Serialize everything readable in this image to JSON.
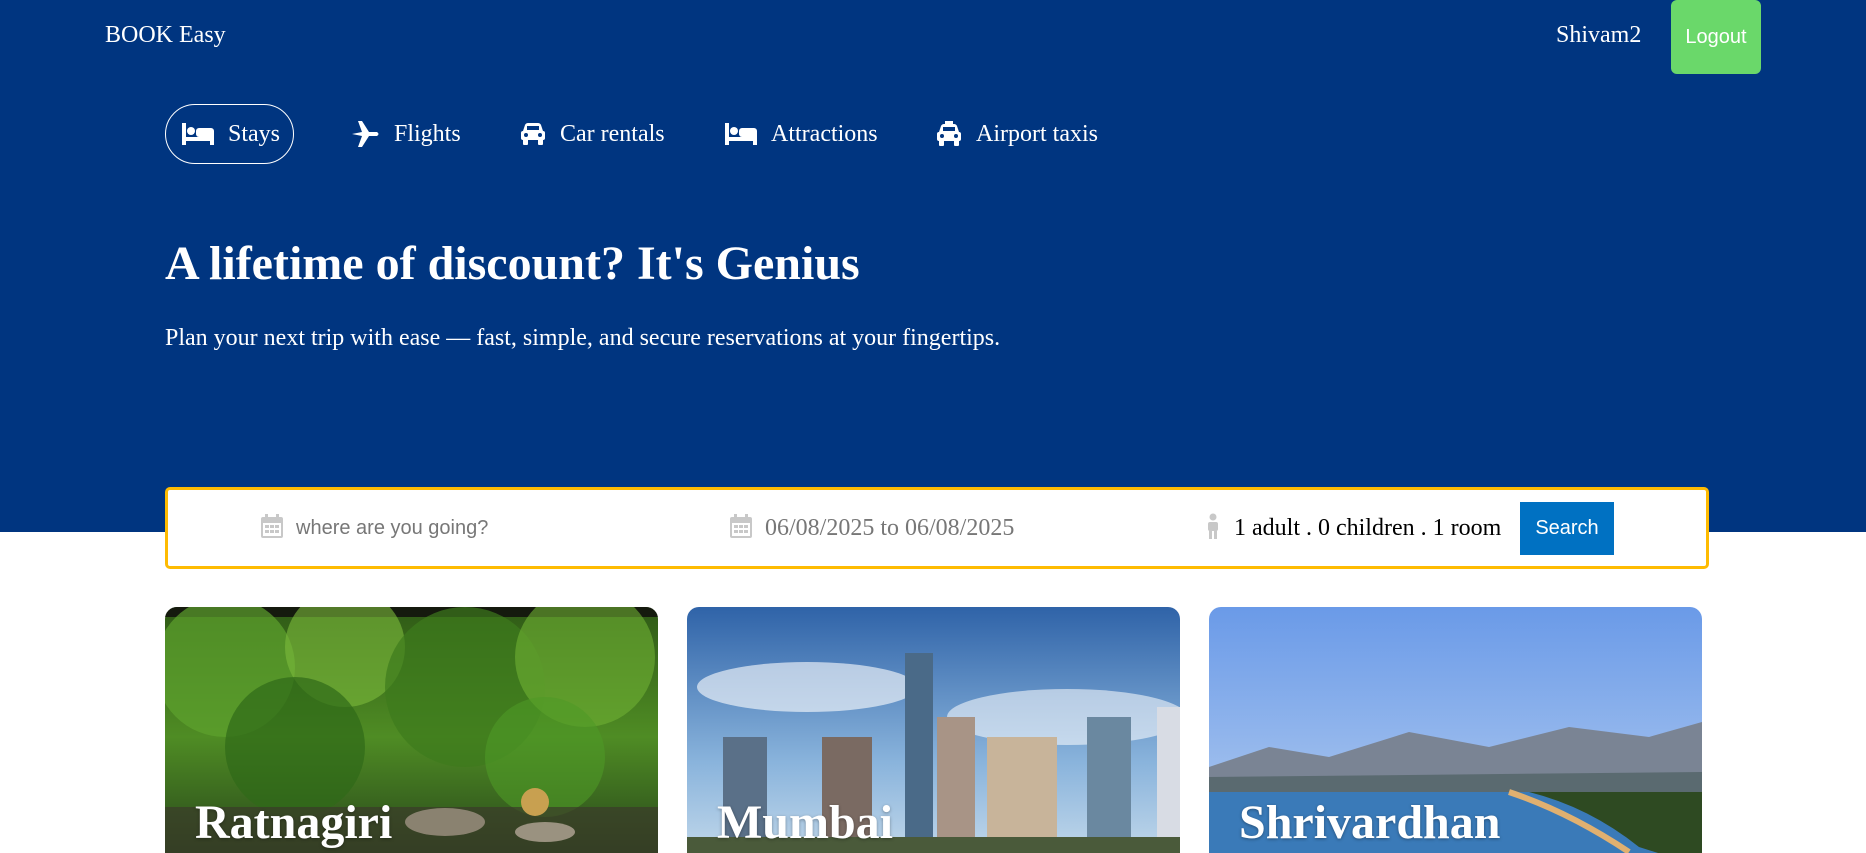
{
  "navbar": {
    "logo": "BOOK Easy",
    "username": "Shivam2",
    "logout_label": "Logout"
  },
  "tabs": [
    {
      "label": "Stays",
      "icon": "bed-icon",
      "active": true
    },
    {
      "label": "Flights",
      "icon": "plane-icon",
      "active": false
    },
    {
      "label": "Car rentals",
      "icon": "car-icon",
      "active": false
    },
    {
      "label": "Attractions",
      "icon": "bed-icon",
      "active": false
    },
    {
      "label": "Airport taxis",
      "icon": "taxi-icon",
      "active": false
    }
  ],
  "hero": {
    "title": "A lifetime of discount? It's Genius",
    "subtitle": "Plan your next trip with ease — fast, simple, and secure reservations at your fingertips."
  },
  "search": {
    "destination_placeholder": "where are you going?",
    "date_range": "06/08/2025 to 06/08/2025",
    "guests": "1 adult . 0 children . 1 room",
    "search_label": "Search"
  },
  "cities": [
    {
      "name": "Ratnagiri"
    },
    {
      "name": "Mumbai"
    },
    {
      "name": "Shrivardhan"
    }
  ],
  "colors": {
    "header_bg": "#003580",
    "logout_bg": "#6ad86a",
    "search_border": "#febb02",
    "search_button": "#0071c2"
  }
}
